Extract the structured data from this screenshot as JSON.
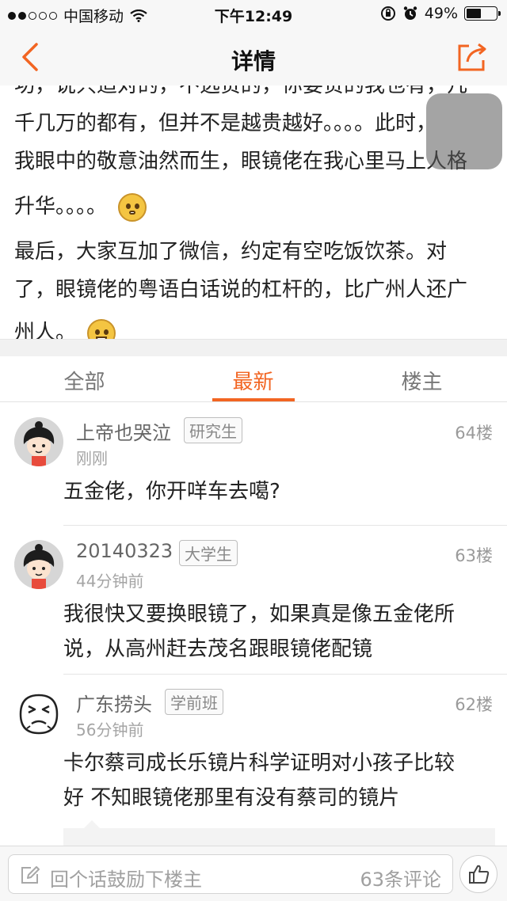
{
  "status_bar": {
    "carrier": "中国移动",
    "time": "下午12:49",
    "battery": "49%",
    "battery_level": 0.49,
    "signal_bars_filled": 2,
    "signal_bars_total": 5
  },
  "nav": {
    "title": "详情",
    "back_icon": "chevron-left-icon",
    "share_icon": "share-icon",
    "accent_color": "#f26522"
  },
  "article": {
    "lines": [
      "功，说只适对的，不选贵的，你要贵的我也有，几",
      "千几万的都有，但并不是越贵越好。。。。此时，",
      "我眼中的敬意油然而生，眼镜佬在我心里马上人格",
      "升华。。。。",
      "最后，大家互加了微信，约定有空吃饭饮茶。对",
      "了，眼镜佬的粤语白话说的杠杆的，比广州人还广",
      "州人。"
    ]
  },
  "tabs": [
    {
      "label": "全部",
      "active": false
    },
    {
      "label": "最新",
      "active": true
    },
    {
      "label": "楼主",
      "active": false
    }
  ],
  "comments": [
    {
      "username": "上帝也哭泣",
      "level": "研究生",
      "floor": "64楼",
      "time": "刚刚",
      "lines": [
        "五金佬，你开咩车去噶?"
      ],
      "avatar": "girl-avatar"
    },
    {
      "username": "20140323",
      "level": "大学生",
      "floor": "63楼",
      "time": "44分钟前",
      "lines": [
        "我很快又要换眼镜了，如果真是像五金佬所",
        "说，从高州赶去茂名跟眼镜佬配镜"
      ],
      "avatar": "girl-avatar"
    },
    {
      "username": "广东捞头",
      "level": "学前班",
      "floor": "62楼",
      "time": "56分钟前",
      "lines": [
        "卡尔蔡司成长乐镜片科学证明对小孩子比较",
        "好  不知眼镜佬那里有没有蔡司的镜片"
      ],
      "avatar": "sad-face-avatar"
    }
  ],
  "bottom_bar": {
    "placeholder": "回个话鼓励下楼主",
    "comment_count": "63条评论",
    "like_icon": "thumbs-up-icon"
  }
}
